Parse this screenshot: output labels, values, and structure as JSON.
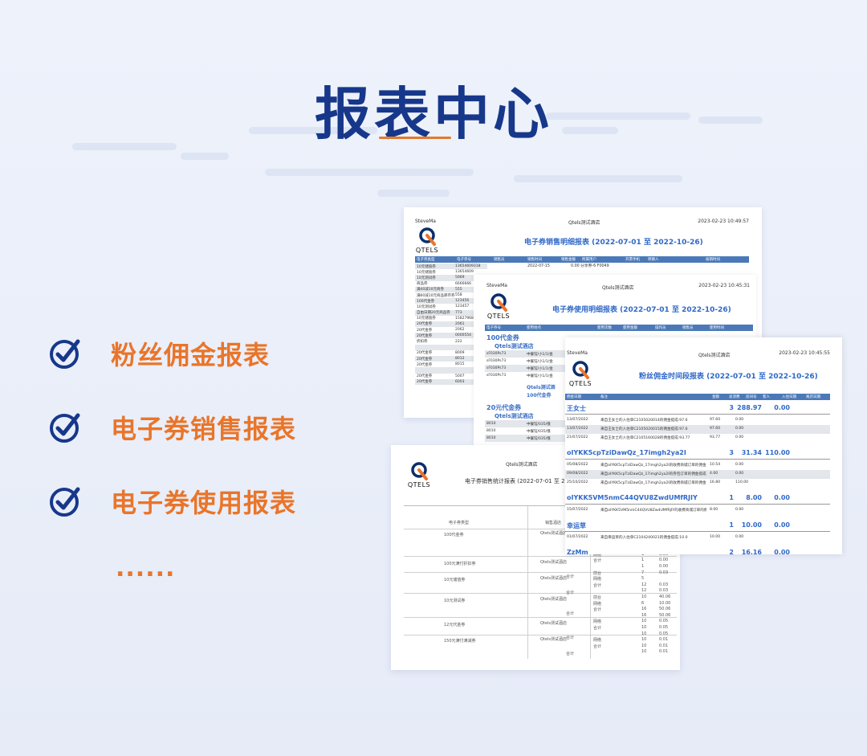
{
  "page": {
    "title": "报表中心",
    "features": [
      {
        "label": "粉丝佣金报表",
        "icon": "check-circle-icon"
      },
      {
        "label": "电子券销售报表",
        "icon": "check-circle-icon"
      },
      {
        "label": "电子券使用报表",
        "icon": "check-circle-icon"
      }
    ],
    "ellipsis": "......",
    "colors": {
      "title": "#17378a",
      "accent": "#e9752a",
      "report_blue": "#2f69c8",
      "header_bar": "#4b79b8"
    }
  },
  "report1": {
    "user": "SteveMa",
    "hotel": "Qtels测试酒店",
    "date": "2023-02-23 10:49:57",
    "title": "电子券销售明细报表 (2022-07-01 至 2022-10-26)",
    "logo_text": "QTELS",
    "headers": [
      "电子券类型",
      "电子券号",
      "销售员",
      "销售时间",
      "销售金额",
      "所属用户",
      "开票手机",
      "转赠人",
      "核销时间"
    ],
    "rows": [
      [
        "10元储值券",
        "13654609318",
        "2022-07-15",
        "0.00",
        "分享券-6 F0049"
      ],
      [
        "10元储值券",
        "13654609"
      ],
      [
        "10元测试券",
        "5069"
      ],
      [
        "商品券",
        "6666666"
      ],
      [
        "满40减10元商券",
        "555"
      ],
      [
        "满60减10元商品库存券",
        "558"
      ],
      [
        "100代金券",
        "123456"
      ],
      [
        "10元测试券",
        "123457"
      ],
      [
        "自由日期20元商品券",
        "773"
      ],
      [
        "10元储值券",
        "15827968"
      ],
      [
        "20代金券",
        "2061"
      ],
      [
        "20代金券",
        "2062"
      ],
      [
        "20代金券",
        "0000554"
      ],
      [
        "折扣券",
        "222"
      ],
      [
        "",
        ""
      ],
      [
        "20代金券",
        "8009"
      ],
      [
        "20代金券",
        "8012"
      ],
      [
        "20代金券",
        "8015"
      ],
      [
        "",
        ""
      ],
      [
        "20代金券",
        "5007"
      ],
      [
        "20代金券",
        "6003"
      ]
    ]
  },
  "report2": {
    "user": "SteveMa",
    "hotel": "Qtels测试酒店",
    "date": "2023-02-23 10:45:31",
    "title": "电子券使用明细报表 (2022-07-01 至 2022-10-26)",
    "logo_text": "QTELS",
    "headers": [
      "电子券号",
      "使用地点",
      "使用次数",
      "使用金额",
      "操作员",
      "销售员",
      "使用时间"
    ],
    "group1": "100代金券",
    "hotel_group": "Qtels测试酒店",
    "rows1": [
      [
        "sF030Ps73",
        "中餐馆/小1/1/金"
      ],
      [
        "sF030Ps73",
        "中餐馆/小1/1/金"
      ],
      [
        "sF030Ps73",
        "中餐馆/小1/1/金"
      ],
      [
        "sF030Ps73",
        "中餐馆/小1/1/金"
      ]
    ],
    "sub1": "Qtels测试酒",
    "sub2": "100代金券",
    "group2": "20元代金券",
    "hotel_group2": "Qtels测试酒店",
    "rows2": [
      [
        "8010",
        "中餐馆/035/俄"
      ],
      [
        "8010",
        "中餐馆/035/俄"
      ],
      [
        "8010",
        "中餐馆/035/俄"
      ]
    ]
  },
  "report3": {
    "user": "SteveMa",
    "hotel": "Qtels测试酒店",
    "date": "2023-02-23 10:45:55",
    "title": "粉丝佣金时间段报表 (2022-07-01 至 2022-10-26)",
    "logo_text": "QTELS",
    "headers": [
      "佣金日期",
      "备注",
      "金额",
      "总消费",
      "房间号",
      "客人",
      "入住日期",
      "离店日期"
    ],
    "groups": [
      {
        "name": "王女士",
        "count": "3",
        "amount": "288.97",
        "extra": "0.00",
        "rows": [
          [
            "13/07/2022",
            "来自王女士的入住单C2105020014的佣金提成:97.6",
            "97.60",
            "0.00"
          ],
          [
            "13/07/2022",
            "来自王女士的入住单C2105020015的佣金提成:97.6",
            "97.60",
            "0.00"
          ],
          [
            "21/07/2022",
            "来自王女士的入住单C2105160028的佣金提成:93.77",
            "93.77",
            "0.00"
          ]
        ]
      },
      {
        "name": "oIYKK5cpTziDawQz_17imgh2ya2I",
        "count": "3",
        "amount": "31.34",
        "extra": "110.00",
        "rows": [
          [
            "05/08/2022",
            "来自oIYKK5cpTziDawQz_17imgh2ya2I的收费商城订单的佣金提成:10.54",
            "10.54",
            "0.00"
          ],
          [
            "09/08/2022",
            "来自oIYKK5cpTziDawQz_17imgh2ya2I的券包订单的佣金提成:4.0",
            "4.00",
            "0.00"
          ],
          [
            "25/10/2022",
            "来自oIYKK5cpTziDawQz_17imgh2ya2I的收费商城订单的佣金提成:16.8",
            "16.80",
            "110.00"
          ]
        ]
      },
      {
        "name": "oIYKK5VM5nmC44QVU8ZwdUMfRJIY",
        "count": "1",
        "amount": "8.00",
        "extra": "0.00",
        "rows": [
          [
            "15/07/2022",
            "来自oIYKK5VM5nmC44QVU8ZwdUMfRJIY的收费商城订单的佣金提成:8.0",
            "8.00",
            "0.00"
          ]
        ]
      },
      {
        "name": "幸运草",
        "count": "1",
        "amount": "10.00",
        "extra": "0.00",
        "rows": [
          [
            "01/07/2022",
            "来自幸运草的入住单C2104240021的佣金提成:10.0",
            "10.00",
            "0.00"
          ]
        ]
      },
      {
        "name": "ZzMm",
        "count": "2",
        "amount": "16.16",
        "extra": "0.00",
        "rows": []
      }
    ]
  },
  "report4": {
    "hotel": "Qtels测试酒店",
    "title": "电子券销售统计报表 (2022-07-01 至 20",
    "logo_text": "QTELS",
    "col1": "电子券类型",
    "col2": "销售酒店",
    "types": [
      {
        "name": "100代金券",
        "hotel": "Qtels测试酒店"
      },
      {
        "name": "100元满付折扣券",
        "hotel": "Qtels测试酒店"
      },
      {
        "name": "10元储值券",
        "hotel": "Qtels测试酒店"
      },
      {
        "name": "10元测试券",
        "hotel": "Qtels测试酒店"
      },
      {
        "name": "12元代金券",
        "hotel": "Qtels测试酒店"
      },
      {
        "name": "150元满付满减券",
        "hotel": "Qtels测试酒店"
      }
    ],
    "total_label": "合计",
    "detail": [
      [
        "",
        "28",
        ""
      ],
      [
        "合计",
        "33",
        "88.00"
      ],
      [
        "合计",
        "33",
        "88.00"
      ],
      [
        "网络",
        "1",
        "0.00"
      ],
      [
        "合计",
        "1",
        "0.00"
      ],
      [
        "",
        "1",
        "0.00"
      ],
      [
        "前台",
        "7",
        "0.03"
      ],
      [
        "网络",
        "5",
        ""
      ],
      [
        "合计",
        "12",
        "0.03"
      ],
      [
        "",
        "12",
        "0.03"
      ],
      [
        "前台",
        "10",
        "40.06"
      ],
      [
        "网络",
        "6",
        "10.00"
      ],
      [
        "合计",
        "16",
        "50.06"
      ],
      [
        "",
        "16",
        "50.06"
      ],
      [
        "网络",
        "10",
        "0.05"
      ],
      [
        "合计",
        "10",
        "0.05"
      ],
      [
        "",
        "10",
        "0.05"
      ],
      [
        "网络",
        "10",
        "0.01"
      ],
      [
        "合计",
        "10",
        "0.01"
      ],
      [
        "",
        "10",
        "0.01"
      ]
    ]
  }
}
